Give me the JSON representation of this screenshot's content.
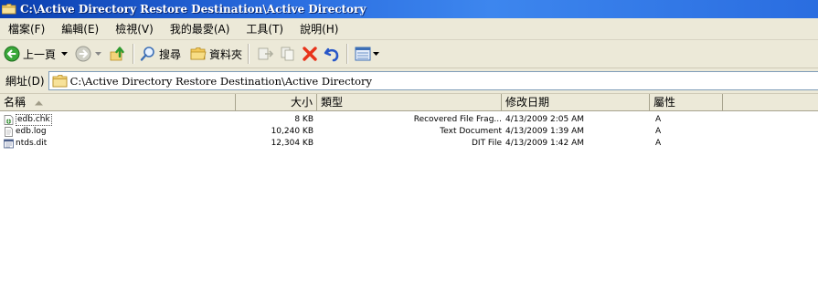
{
  "window": {
    "title": "C:\\Active Directory Restore Destination\\Active Directory"
  },
  "menu": {
    "items": [
      "檔案(F)",
      "編輯(E)",
      "檢視(V)",
      "我的最愛(A)",
      "工具(T)",
      "說明(H)"
    ]
  },
  "toolbar": {
    "back_label": "上一頁",
    "search_label": "搜尋",
    "folders_label": "資料夾"
  },
  "address": {
    "label": "網址(D)",
    "value": "C:\\Active Directory Restore Destination\\Active Directory"
  },
  "columns": {
    "name": "名稱",
    "size": "大小",
    "type": "類型",
    "modified": "修改日期",
    "attributes": "屬性"
  },
  "files": [
    {
      "name": "edb.chk",
      "size": "8 KB",
      "type": "Recovered File Frag...",
      "modified": "4/13/2009 2:05 AM",
      "attr": "A",
      "icon": "recovered-file-icon"
    },
    {
      "name": "edb.log",
      "size": "10,240 KB",
      "type": "Text Document",
      "modified": "4/13/2009 1:39 AM",
      "attr": "A",
      "icon": "text-document-icon"
    },
    {
      "name": "ntds.dit",
      "size": "12,304 KB",
      "type": "DIT File",
      "modified": "4/13/2009 1:42 AM",
      "attr": "A",
      "icon": "dit-file-icon"
    }
  ]
}
